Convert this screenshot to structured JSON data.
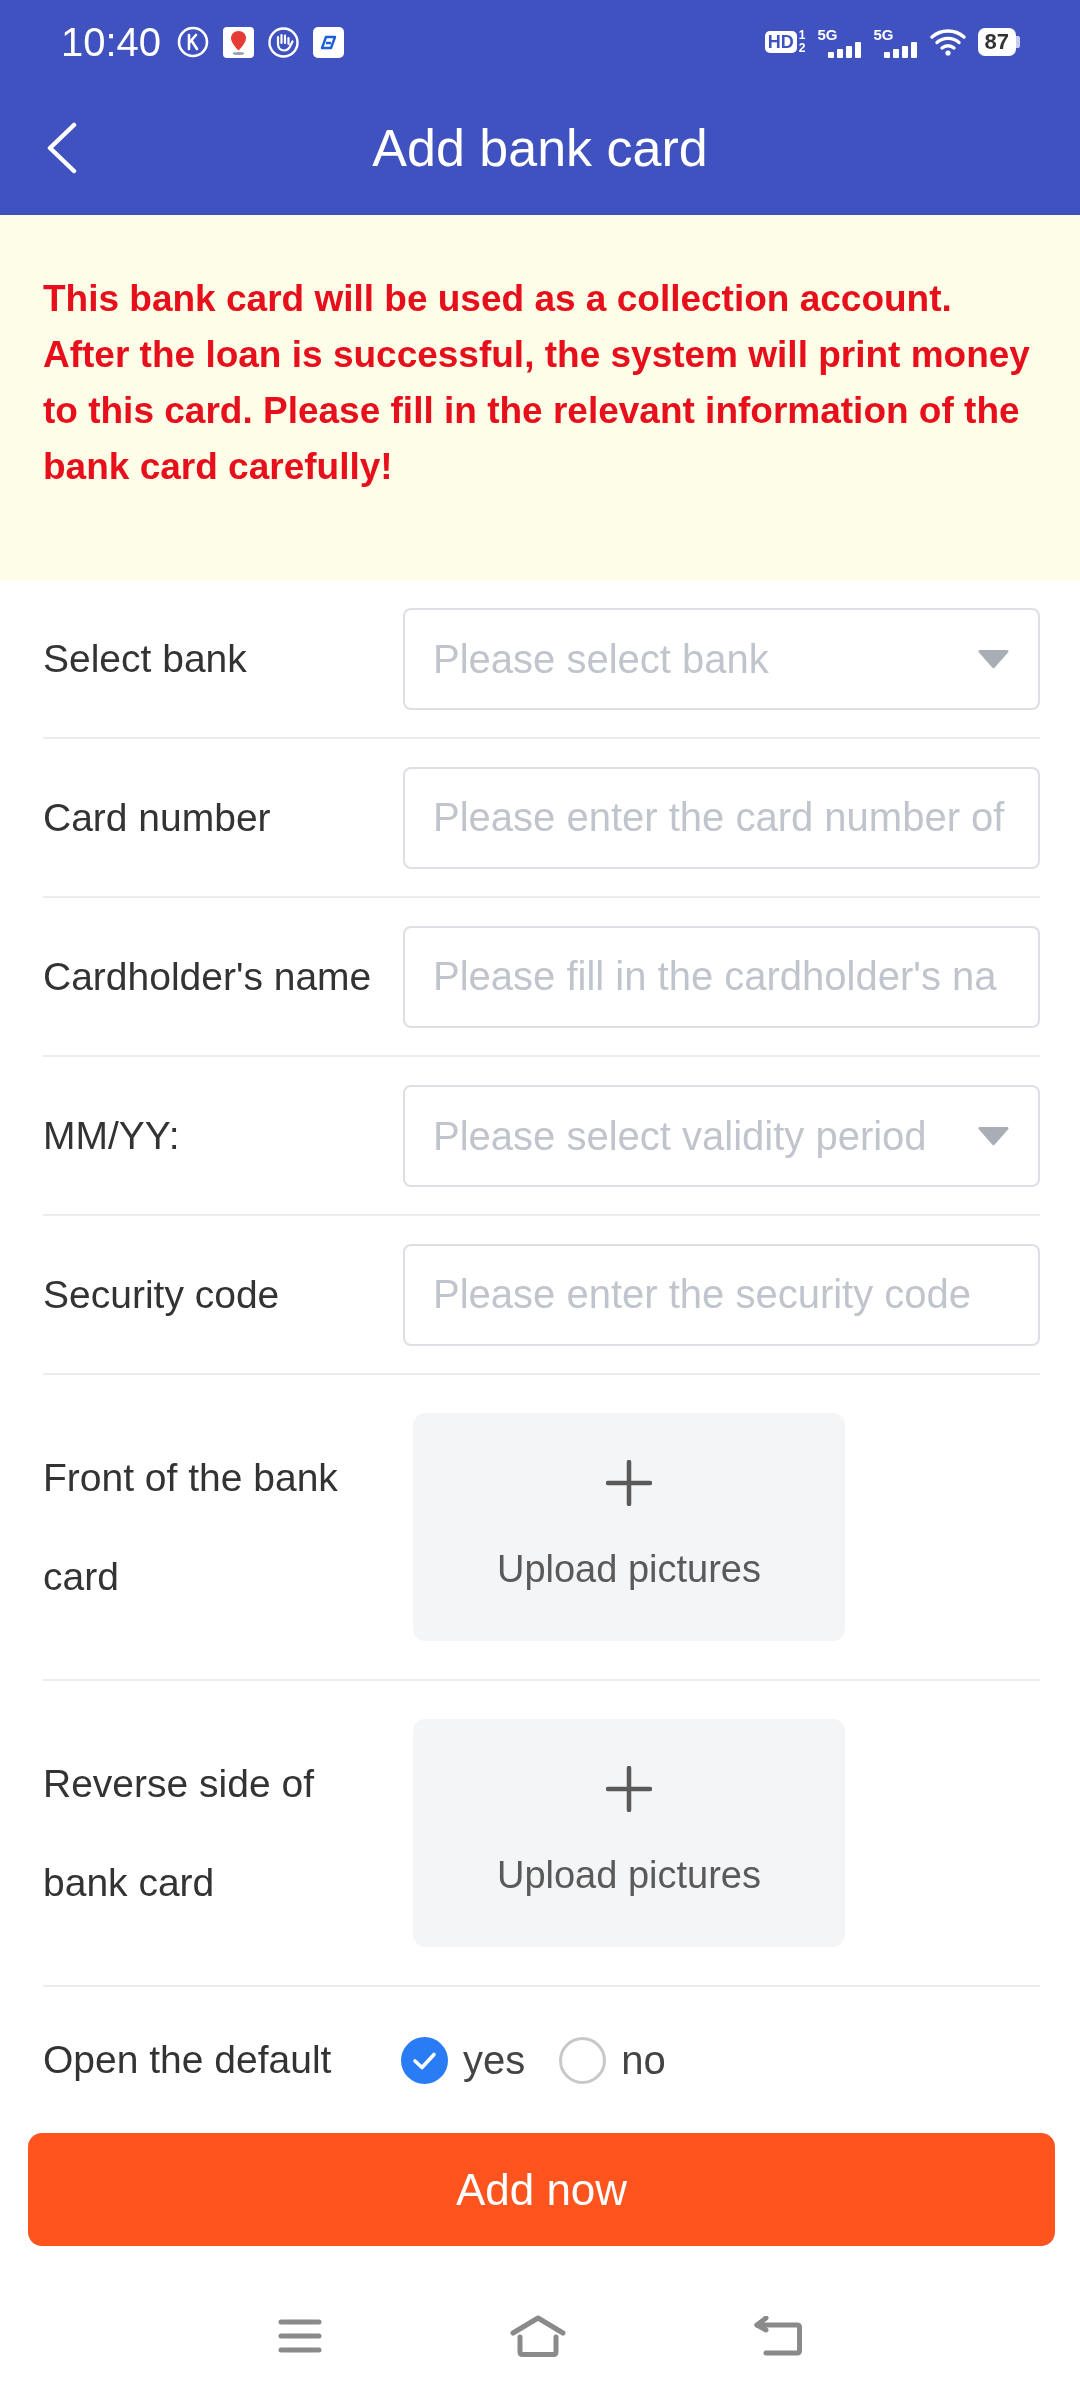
{
  "status_bar": {
    "time": "10:40",
    "hd": "HD",
    "sim_slots": [
      "1",
      "2"
    ],
    "networks": [
      {
        "type": "5G"
      },
      {
        "type": "5G"
      }
    ],
    "battery": "87"
  },
  "header": {
    "title": "Add bank card"
  },
  "notice": {
    "text": "This bank card will be used as a collection account. After the loan is successful, the system will print money to this card. Please fill in the relevant information of the bank card carefully!"
  },
  "form": {
    "rows": [
      {
        "kind": "select",
        "label": "Select bank",
        "placeholder": "Please select bank"
      },
      {
        "kind": "input",
        "label": "Card number",
        "placeholder": "Please enter the card number of"
      },
      {
        "kind": "input",
        "label": "Cardholder's name",
        "placeholder": "Please fill in the cardholder's na"
      },
      {
        "kind": "select",
        "label": "MM/YY:",
        "placeholder": "Please select validity period"
      },
      {
        "kind": "input",
        "label": "Security code",
        "placeholder": "Please enter the security code"
      },
      {
        "kind": "upload",
        "label": "Front of the bank card",
        "button": "Upload pictures"
      },
      {
        "kind": "upload",
        "label": "Reverse side of bank card",
        "button": "Upload pictures"
      }
    ]
  },
  "default_option": {
    "label": "Open the default",
    "options": [
      {
        "label": "yes",
        "selected": true
      },
      {
        "label": "no",
        "selected": false
      }
    ]
  },
  "submit_button": {
    "label": "Add now"
  }
}
